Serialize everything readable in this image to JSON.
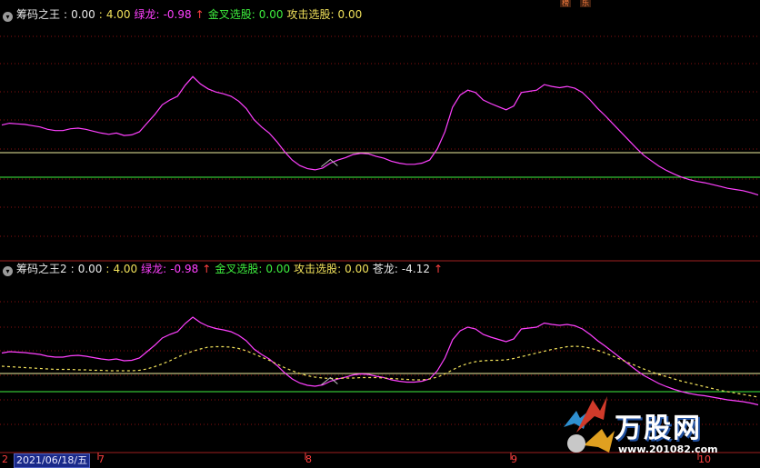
{
  "top_badges": [
    {
      "label": "榜"
    },
    {
      "label": "乐"
    }
  ],
  "panels": [
    {
      "id": "panel1",
      "header": {
        "title": "筹码之王",
        "sep": ":",
        "v1": "0.00",
        "v2": "4.00",
        "lvlong_label": "绿龙:",
        "lvlong_value": "-0.98",
        "lvlong_arrow": "↑",
        "jincha_label": "金叉选股:",
        "jincha_value": "0.00",
        "gongji_label": "攻击选股:",
        "gongji_value": "0.00"
      }
    },
    {
      "id": "panel2",
      "header": {
        "title": "筹码之王2",
        "sep": ":",
        "v1": "0.00",
        "v2": "4.00",
        "lvlong_label": "绿龙:",
        "lvlong_value": "-0.98",
        "lvlong_arrow": "↑",
        "jincha_label": "金叉选股:",
        "jincha_value": "0.00",
        "gongji_label": "攻击选股:",
        "gongji_value": "0.00",
        "canglong_label": "苍龙:",
        "canglong_value": "-4.12",
        "canglong_arrow": "↑"
      }
    }
  ],
  "xaxis": {
    "date_label": "2021/06/18/五",
    "left_label": "2",
    "ticks": [
      "7",
      "8",
      "9",
      "10"
    ]
  },
  "watermark": {
    "text": "万股网",
    "url": "www.201082.com"
  },
  "chart_data": {
    "type": "line",
    "colors": {
      "lvlong": "#ff40ff",
      "canglong": "#f0e05a",
      "level_4": "#f0f0a0",
      "level_0": "#3ff03f",
      "grid": "#8a1010",
      "cross_marker": "#c0c0c0"
    },
    "ylim": [
      -5,
      15
    ],
    "levels": [
      4,
      0
    ],
    "x_count": 100,
    "lvlong": [
      8.5,
      8.8,
      8.7,
      8.6,
      8.4,
      8.2,
      7.8,
      7.6,
      7.6,
      7.9,
      8.0,
      7.8,
      7.5,
      7.2,
      7.0,
      7.2,
      6.8,
      6.9,
      7.4,
      8.8,
      10.2,
      11.8,
      12.6,
      13.2,
      15.0,
      16.4,
      15.2,
      14.4,
      13.9,
      13.6,
      13.2,
      12.4,
      11.2,
      9.4,
      8.2,
      7.2,
      5.8,
      4.2,
      2.8,
      1.9,
      1.4,
      1.2,
      1.5,
      2.3,
      2.8,
      3.2,
      3.7,
      3.9,
      3.8,
      3.4,
      3.1,
      2.6,
      2.3,
      2.1,
      2.1,
      2.3,
      2.8,
      4.6,
      7.4,
      11.4,
      13.4,
      14.2,
      13.8,
      12.6,
      12.0,
      11.5,
      11.0,
      11.6,
      13.8,
      14.0,
      14.2,
      15.1,
      14.8,
      14.6,
      14.8,
      14.5,
      13.8,
      12.6,
      11.2,
      10.0,
      8.7,
      7.4,
      6.1,
      4.8,
      3.6,
      2.7,
      1.8,
      1.1,
      0.5,
      0.0,
      -0.4,
      -0.7,
      -0.9,
      -1.2,
      -1.5,
      -1.8,
      -2.0,
      -2.2,
      -2.5,
      -2.9
    ],
    "canglong": [
      5.6,
      5.5,
      5.4,
      5.3,
      5.2,
      5.1,
      5.0,
      4.9,
      4.9,
      4.9,
      4.8,
      4.8,
      4.7,
      4.7,
      4.6,
      4.6,
      4.6,
      4.6,
      4.7,
      5.0,
      5.5,
      6.1,
      6.8,
      7.6,
      8.3,
      8.9,
      9.4,
      9.8,
      9.9,
      9.9,
      9.8,
      9.5,
      9.0,
      8.3,
      7.6,
      6.9,
      6.1,
      5.3,
      4.6,
      4.0,
      3.5,
      3.2,
      3.0,
      2.9,
      2.9,
      3.0,
      3.0,
      3.1,
      3.1,
      3.1,
      3.0,
      2.9,
      2.8,
      2.7,
      2.6,
      2.6,
      2.8,
      3.2,
      3.9,
      4.8,
      5.6,
      6.2,
      6.6,
      6.8,
      6.9,
      6.9,
      7.0,
      7.3,
      7.7,
      8.1,
      8.5,
      8.9,
      9.3,
      9.6,
      9.9,
      10.0,
      9.9,
      9.6,
      9.1,
      8.5,
      7.8,
      7.1,
      6.4,
      5.7,
      5.0,
      4.4,
      3.8,
      3.3,
      2.8,
      2.3,
      1.9,
      1.5,
      1.1,
      0.7,
      0.3,
      0.0,
      -0.3,
      -0.6,
      -0.9,
      -1.2
    ]
  }
}
